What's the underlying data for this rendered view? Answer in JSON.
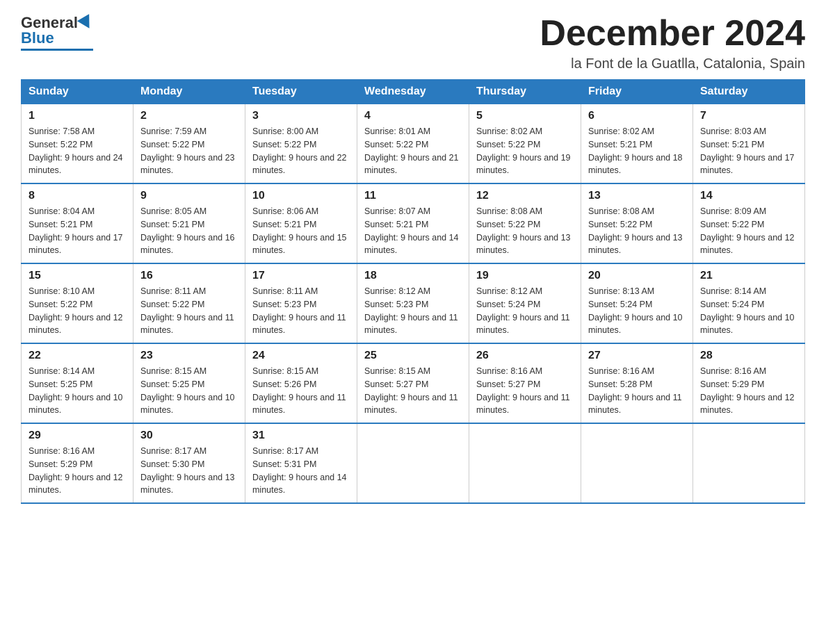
{
  "logo": {
    "general": "General",
    "blue": "Blue"
  },
  "header": {
    "title": "December 2024",
    "location": "la Font de la Guatlla, Catalonia, Spain"
  },
  "weekdays": [
    "Sunday",
    "Monday",
    "Tuesday",
    "Wednesday",
    "Thursday",
    "Friday",
    "Saturday"
  ],
  "weeks": [
    [
      {
        "day": "1",
        "sunrise": "Sunrise: 7:58 AM",
        "sunset": "Sunset: 5:22 PM",
        "daylight": "Daylight: 9 hours and 24 minutes."
      },
      {
        "day": "2",
        "sunrise": "Sunrise: 7:59 AM",
        "sunset": "Sunset: 5:22 PM",
        "daylight": "Daylight: 9 hours and 23 minutes."
      },
      {
        "day": "3",
        "sunrise": "Sunrise: 8:00 AM",
        "sunset": "Sunset: 5:22 PM",
        "daylight": "Daylight: 9 hours and 22 minutes."
      },
      {
        "day": "4",
        "sunrise": "Sunrise: 8:01 AM",
        "sunset": "Sunset: 5:22 PM",
        "daylight": "Daylight: 9 hours and 21 minutes."
      },
      {
        "day": "5",
        "sunrise": "Sunrise: 8:02 AM",
        "sunset": "Sunset: 5:22 PM",
        "daylight": "Daylight: 9 hours and 19 minutes."
      },
      {
        "day": "6",
        "sunrise": "Sunrise: 8:02 AM",
        "sunset": "Sunset: 5:21 PM",
        "daylight": "Daylight: 9 hours and 18 minutes."
      },
      {
        "day": "7",
        "sunrise": "Sunrise: 8:03 AM",
        "sunset": "Sunset: 5:21 PM",
        "daylight": "Daylight: 9 hours and 17 minutes."
      }
    ],
    [
      {
        "day": "8",
        "sunrise": "Sunrise: 8:04 AM",
        "sunset": "Sunset: 5:21 PM",
        "daylight": "Daylight: 9 hours and 17 minutes."
      },
      {
        "day": "9",
        "sunrise": "Sunrise: 8:05 AM",
        "sunset": "Sunset: 5:21 PM",
        "daylight": "Daylight: 9 hours and 16 minutes."
      },
      {
        "day": "10",
        "sunrise": "Sunrise: 8:06 AM",
        "sunset": "Sunset: 5:21 PM",
        "daylight": "Daylight: 9 hours and 15 minutes."
      },
      {
        "day": "11",
        "sunrise": "Sunrise: 8:07 AM",
        "sunset": "Sunset: 5:21 PM",
        "daylight": "Daylight: 9 hours and 14 minutes."
      },
      {
        "day": "12",
        "sunrise": "Sunrise: 8:08 AM",
        "sunset": "Sunset: 5:22 PM",
        "daylight": "Daylight: 9 hours and 13 minutes."
      },
      {
        "day": "13",
        "sunrise": "Sunrise: 8:08 AM",
        "sunset": "Sunset: 5:22 PM",
        "daylight": "Daylight: 9 hours and 13 minutes."
      },
      {
        "day": "14",
        "sunrise": "Sunrise: 8:09 AM",
        "sunset": "Sunset: 5:22 PM",
        "daylight": "Daylight: 9 hours and 12 minutes."
      }
    ],
    [
      {
        "day": "15",
        "sunrise": "Sunrise: 8:10 AM",
        "sunset": "Sunset: 5:22 PM",
        "daylight": "Daylight: 9 hours and 12 minutes."
      },
      {
        "day": "16",
        "sunrise": "Sunrise: 8:11 AM",
        "sunset": "Sunset: 5:22 PM",
        "daylight": "Daylight: 9 hours and 11 minutes."
      },
      {
        "day": "17",
        "sunrise": "Sunrise: 8:11 AM",
        "sunset": "Sunset: 5:23 PM",
        "daylight": "Daylight: 9 hours and 11 minutes."
      },
      {
        "day": "18",
        "sunrise": "Sunrise: 8:12 AM",
        "sunset": "Sunset: 5:23 PM",
        "daylight": "Daylight: 9 hours and 11 minutes."
      },
      {
        "day": "19",
        "sunrise": "Sunrise: 8:12 AM",
        "sunset": "Sunset: 5:24 PM",
        "daylight": "Daylight: 9 hours and 11 minutes."
      },
      {
        "day": "20",
        "sunrise": "Sunrise: 8:13 AM",
        "sunset": "Sunset: 5:24 PM",
        "daylight": "Daylight: 9 hours and 10 minutes."
      },
      {
        "day": "21",
        "sunrise": "Sunrise: 8:14 AM",
        "sunset": "Sunset: 5:24 PM",
        "daylight": "Daylight: 9 hours and 10 minutes."
      }
    ],
    [
      {
        "day": "22",
        "sunrise": "Sunrise: 8:14 AM",
        "sunset": "Sunset: 5:25 PM",
        "daylight": "Daylight: 9 hours and 10 minutes."
      },
      {
        "day": "23",
        "sunrise": "Sunrise: 8:15 AM",
        "sunset": "Sunset: 5:25 PM",
        "daylight": "Daylight: 9 hours and 10 minutes."
      },
      {
        "day": "24",
        "sunrise": "Sunrise: 8:15 AM",
        "sunset": "Sunset: 5:26 PM",
        "daylight": "Daylight: 9 hours and 11 minutes."
      },
      {
        "day": "25",
        "sunrise": "Sunrise: 8:15 AM",
        "sunset": "Sunset: 5:27 PM",
        "daylight": "Daylight: 9 hours and 11 minutes."
      },
      {
        "day": "26",
        "sunrise": "Sunrise: 8:16 AM",
        "sunset": "Sunset: 5:27 PM",
        "daylight": "Daylight: 9 hours and 11 minutes."
      },
      {
        "day": "27",
        "sunrise": "Sunrise: 8:16 AM",
        "sunset": "Sunset: 5:28 PM",
        "daylight": "Daylight: 9 hours and 11 minutes."
      },
      {
        "day": "28",
        "sunrise": "Sunrise: 8:16 AM",
        "sunset": "Sunset: 5:29 PM",
        "daylight": "Daylight: 9 hours and 12 minutes."
      }
    ],
    [
      {
        "day": "29",
        "sunrise": "Sunrise: 8:16 AM",
        "sunset": "Sunset: 5:29 PM",
        "daylight": "Daylight: 9 hours and 12 minutes."
      },
      {
        "day": "30",
        "sunrise": "Sunrise: 8:17 AM",
        "sunset": "Sunset: 5:30 PM",
        "daylight": "Daylight: 9 hours and 13 minutes."
      },
      {
        "day": "31",
        "sunrise": "Sunrise: 8:17 AM",
        "sunset": "Sunset: 5:31 PM",
        "daylight": "Daylight: 9 hours and 14 minutes."
      },
      null,
      null,
      null,
      null
    ]
  ]
}
